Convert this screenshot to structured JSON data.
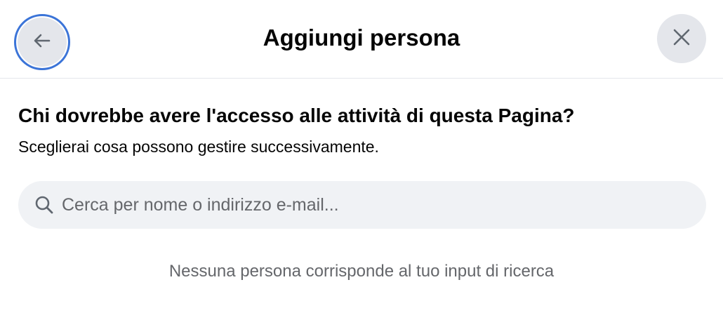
{
  "header": {
    "title": "Aggiungi persona",
    "back_icon": "arrow-left-icon",
    "close_icon": "close-icon"
  },
  "main": {
    "question": "Chi dovrebbe avere l'accesso alle attività di questa Pagina?",
    "subtitle": "Sceglierai cosa possono gestire successivamente.",
    "search": {
      "placeholder": "Cerca per nome o indirizzo e-mail...",
      "value": "",
      "icon": "search-icon"
    },
    "empty_message": "Nessuna persona corrisponde al tuo input di ricerca"
  },
  "colors": {
    "focus_ring": "#3b74d8",
    "button_bg": "#e4e6eb",
    "input_bg": "#f0f2f5",
    "secondary_text": "#65676b",
    "primary_text": "#050505"
  }
}
